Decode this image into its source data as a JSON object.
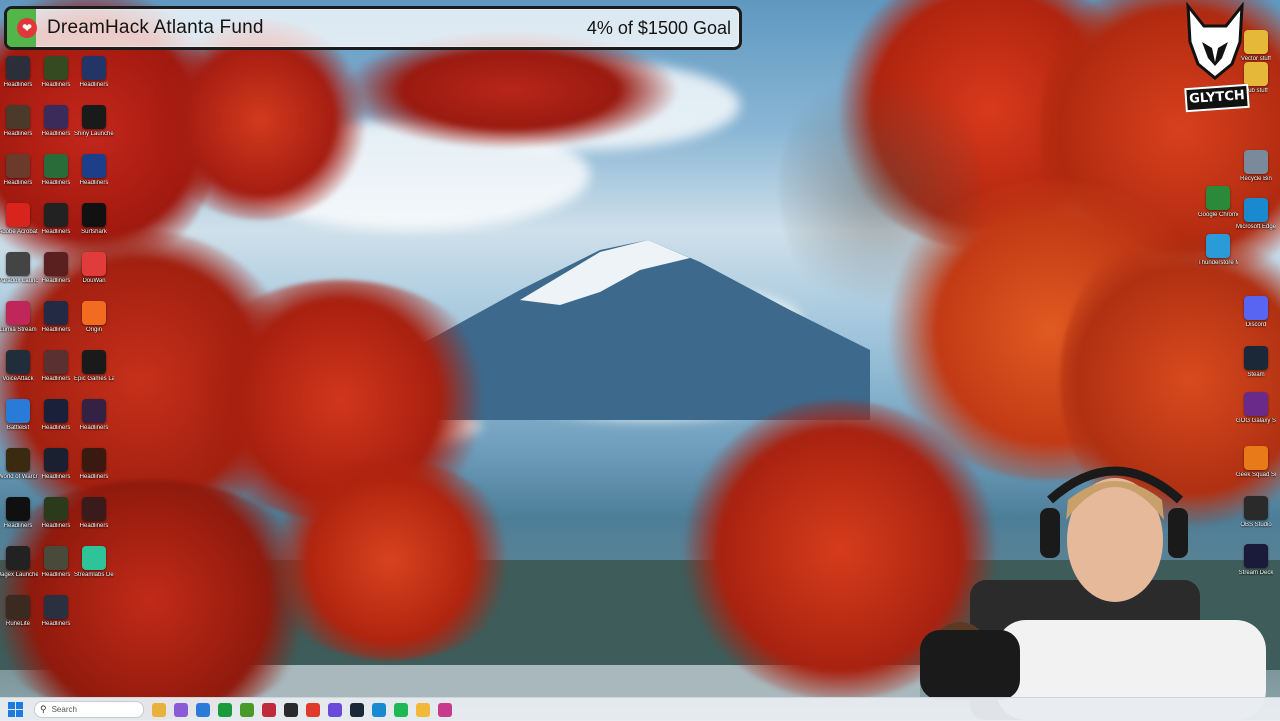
{
  "fund_bar": {
    "title": "DreamHack Atlanta Fund",
    "goal_text": "4% of $1500 Goal",
    "progress_percent": 4,
    "icon": "heart-icon",
    "accent_color": "#53b64a"
  },
  "overlay_logo": {
    "text": "GLYTCH"
  },
  "desktop_icons_left": [
    {
      "label": "Headliners",
      "color": "#2a2f3a"
    },
    {
      "label": "Headliners",
      "color": "#364a22"
    },
    {
      "label": "Headliners",
      "color": "#223566"
    },
    {
      "label": "Headliners",
      "color": "#4b3a2a"
    },
    {
      "label": "Headliners",
      "color": "#3b2b5a"
    },
    {
      "label": "Shiny Launcher",
      "color": "#1a1a1a"
    },
    {
      "label": "Headliners",
      "color": "#6b3a2a"
    },
    {
      "label": "Headliners",
      "color": "#2a6b3a"
    },
    {
      "label": "Headliners",
      "color": "#1d3f8a"
    },
    {
      "label": "Adobe Acrobat",
      "color": "#d8241c"
    },
    {
      "label": "Headliners",
      "color": "#222222"
    },
    {
      "label": "Surfshark",
      "color": "#111111"
    },
    {
      "label": "Paradox Launcher",
      "color": "#444444"
    },
    {
      "label": "Headliners",
      "color": "#5a2020"
    },
    {
      "label": "DouWan",
      "color": "#e23b3b"
    },
    {
      "label": "Lumia Stream",
      "color": "#c0265a"
    },
    {
      "label": "Headliners",
      "color": "#222a44"
    },
    {
      "label": "Origin",
      "color": "#f26b20"
    },
    {
      "label": "VoiceAttack",
      "color": "#1f2e3a"
    },
    {
      "label": "Headliners",
      "color": "#5a3030"
    },
    {
      "label": "Epic Games Launcher",
      "color": "#1a1a1a"
    },
    {
      "label": "BattleBit",
      "color": "#2a7ad8"
    },
    {
      "label": "Headliners",
      "color": "#1a1f3a"
    },
    {
      "label": "Headliners",
      "color": "#332244"
    },
    {
      "label": "World of Warcraft",
      "color": "#3a2a10"
    },
    {
      "label": "Headliners",
      "color": "#1a2030"
    },
    {
      "label": "Headliners",
      "color": "#3a1a10"
    },
    {
      "label": "Headliners",
      "color": "#101010"
    },
    {
      "label": "Headliners",
      "color": "#2a3a1a"
    },
    {
      "label": "Headliners",
      "color": "#3a1a1a"
    },
    {
      "label": "Jagex Launcher",
      "color": "#222222"
    },
    {
      "label": "Headliners",
      "color": "#4a4a3a"
    },
    {
      "label": "Streamlabs Desktop",
      "color": "#2fc39a"
    },
    {
      "label": "RuneLite",
      "color": "#3a2a20"
    },
    {
      "label": "Headliners",
      "color": "#2a3040"
    }
  ],
  "desktop_icons_right": [
    {
      "label": "Vector stuff",
      "color": "#e6b83a"
    },
    {
      "label": "Sub stuff",
      "color": "#e6b83a"
    },
    {
      "label": "Recycle Bin",
      "color": "#7a8a9a"
    },
    {
      "label": "Google Chrome",
      "color": "#2a8a3a"
    },
    {
      "label": "Microsoft Edge",
      "color": "#1a8ad0"
    },
    {
      "label": "Thunderstore Mod Manager",
      "color": "#2a9ad8"
    },
    {
      "label": "Discord",
      "color": "#5865f2"
    },
    {
      "label": "Steam",
      "color": "#1b2838"
    },
    {
      "label": "GOG Galaxy Shortcut",
      "color": "#6a2a8a"
    },
    {
      "label": "Geek Squad Support",
      "color": "#e87a1a"
    },
    {
      "label": "OBS Studio",
      "color": "#2a2a2a"
    },
    {
      "label": "Stream Deck",
      "color": "#1a1a3a"
    }
  ],
  "taskbar": {
    "search_placeholder": "Search",
    "start_icon": "windows-start-icon",
    "apps": [
      {
        "name": "file-explorer-icon",
        "color": "#e8b23a"
      },
      {
        "name": "copilot-icon",
        "color": "#8a5ad8"
      },
      {
        "name": "store-icon",
        "color": "#2a7ad8"
      },
      {
        "name": "xbox-icon",
        "color": "#1a9a3a"
      },
      {
        "name": "minecraft-icon",
        "color": "#4a9a2a"
      },
      {
        "name": "app-red-icon",
        "color": "#c02a3a"
      },
      {
        "name": "obs-icon",
        "color": "#2a2a2a"
      },
      {
        "name": "chrome-icon",
        "color": "#e03a2a"
      },
      {
        "name": "proton-icon",
        "color": "#6a4ad8"
      },
      {
        "name": "steam-icon",
        "color": "#1b2838"
      },
      {
        "name": "edge-icon",
        "color": "#1a8ad0"
      },
      {
        "name": "spotify-icon",
        "color": "#1db954"
      },
      {
        "name": "chrome-2-icon",
        "color": "#f2b83a"
      },
      {
        "name": "app-active-icon",
        "color": "#c83a8a"
      }
    ]
  }
}
